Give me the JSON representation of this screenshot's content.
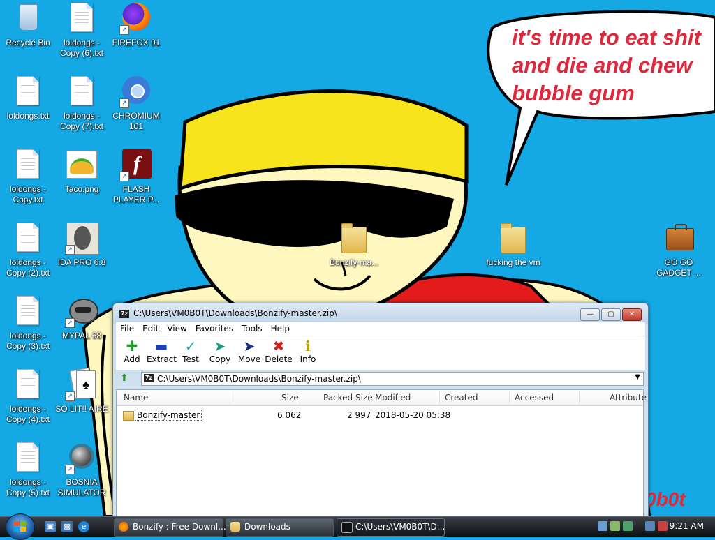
{
  "wallpaper": {
    "speech_text": "it's time to eat shit\nand die and chew\nbubble gum",
    "signature": "0b0t",
    "bg_color": "#14a9e5"
  },
  "desktop_icons": [
    {
      "label": "Recycle Bin",
      "icon": "recycle-bin-icon",
      "shortcut": false
    },
    {
      "label": "loldongs - Copy (6).txt",
      "icon": "text-file-icon",
      "shortcut": false
    },
    {
      "label": "FIREFOX 91",
      "icon": "firefox-icon",
      "shortcut": true
    },
    {
      "label": "loldongs.txt",
      "icon": "text-file-icon",
      "shortcut": false
    },
    {
      "label": "loldongs - Copy (7).txt",
      "icon": "text-file-icon",
      "shortcut": false
    },
    {
      "label": "CHROMIUM 101",
      "icon": "chromium-icon",
      "shortcut": true
    },
    {
      "label": "loldongs - Copy.txt",
      "icon": "text-file-icon",
      "shortcut": false
    },
    {
      "label": "Taco.png",
      "icon": "taco-image-icon",
      "shortcut": false
    },
    {
      "label": "FLASH PLAYER P...",
      "icon": "flash-icon",
      "shortcut": true
    },
    {
      "label": "loldongs - Copy (2).txt",
      "icon": "text-file-icon",
      "shortcut": false
    },
    {
      "label": "IDA PRO 6.8",
      "icon": "ida-pro-icon",
      "shortcut": true
    },
    {
      "label": "Bonzify-ma...",
      "icon": "folder-icon",
      "shortcut": false
    },
    {
      "label": "fucking the vm",
      "icon": "folder-icon",
      "shortcut": false
    },
    {
      "label": "GO GO GADGET ...",
      "icon": "briefcase-icon",
      "shortcut": false
    },
    {
      "label": "loldongs - Copy (3).txt",
      "icon": "text-file-icon",
      "shortcut": false
    },
    {
      "label": "MYPAL 68",
      "icon": "mypal-raccoon-icon",
      "shortcut": true
    },
    {
      "label": "loldongs - Copy (4).txt",
      "icon": "text-file-icon",
      "shortcut": false
    },
    {
      "label": "SO LIT!! AIRE",
      "icon": "solitaire-icon",
      "shortcut": true
    },
    {
      "label": "loldongs - Copy (5).txt",
      "icon": "text-file-icon",
      "shortcut": false
    },
    {
      "label": "BOSNIA SIMULATOR",
      "icon": "minesweeper-icon",
      "shortcut": true
    }
  ],
  "window": {
    "title": "C:\\Users\\VM0B0T\\Downloads\\Bonzify-master.zip\\",
    "menu": [
      "File",
      "Edit",
      "View",
      "Favorites",
      "Tools",
      "Help"
    ],
    "toolbar": [
      {
        "label": "Add",
        "icon": "add-plus-icon",
        "color": "#1f9d2a"
      },
      {
        "label": "Extract",
        "icon": "extract-minus-icon",
        "color": "#1a3fb5"
      },
      {
        "label": "Test",
        "icon": "test-check-icon",
        "color": "#1eb0b0"
      },
      {
        "label": "Copy",
        "icon": "copy-arrow-icon",
        "color": "#1b9a86"
      },
      {
        "label": "Move",
        "icon": "move-arrow-icon",
        "color": "#1b2c8c"
      },
      {
        "label": "Delete",
        "icon": "delete-x-icon",
        "color": "#d41c1c"
      },
      {
        "label": "Info",
        "icon": "info-icon",
        "color": "#b8a000"
      }
    ],
    "address": "C:\\Users\\VM0B0T\\Downloads\\Bonzify-master.zip\\",
    "columns": [
      "Name",
      "Size",
      "Packed Size",
      "Modified",
      "Created",
      "Accessed",
      "Attribute"
    ],
    "rows": [
      {
        "name": "Bonzify-master",
        "size": "6 062",
        "packed": "2 997",
        "modified": "2018-05-20 05:38",
        "created": "",
        "accessed": "",
        "attr": ""
      }
    ]
  },
  "taskbar": {
    "tasks": [
      {
        "label": "Bonzify : Free Downl...",
        "icon": "firefox-icon",
        "active": false
      },
      {
        "label": "Downloads",
        "icon": "folder-icon",
        "active": false
      },
      {
        "label": "C:\\Users\\VM0B0T\\D...",
        "icon": "7zip-icon",
        "active": true
      }
    ],
    "clock": "9:21 AM"
  }
}
